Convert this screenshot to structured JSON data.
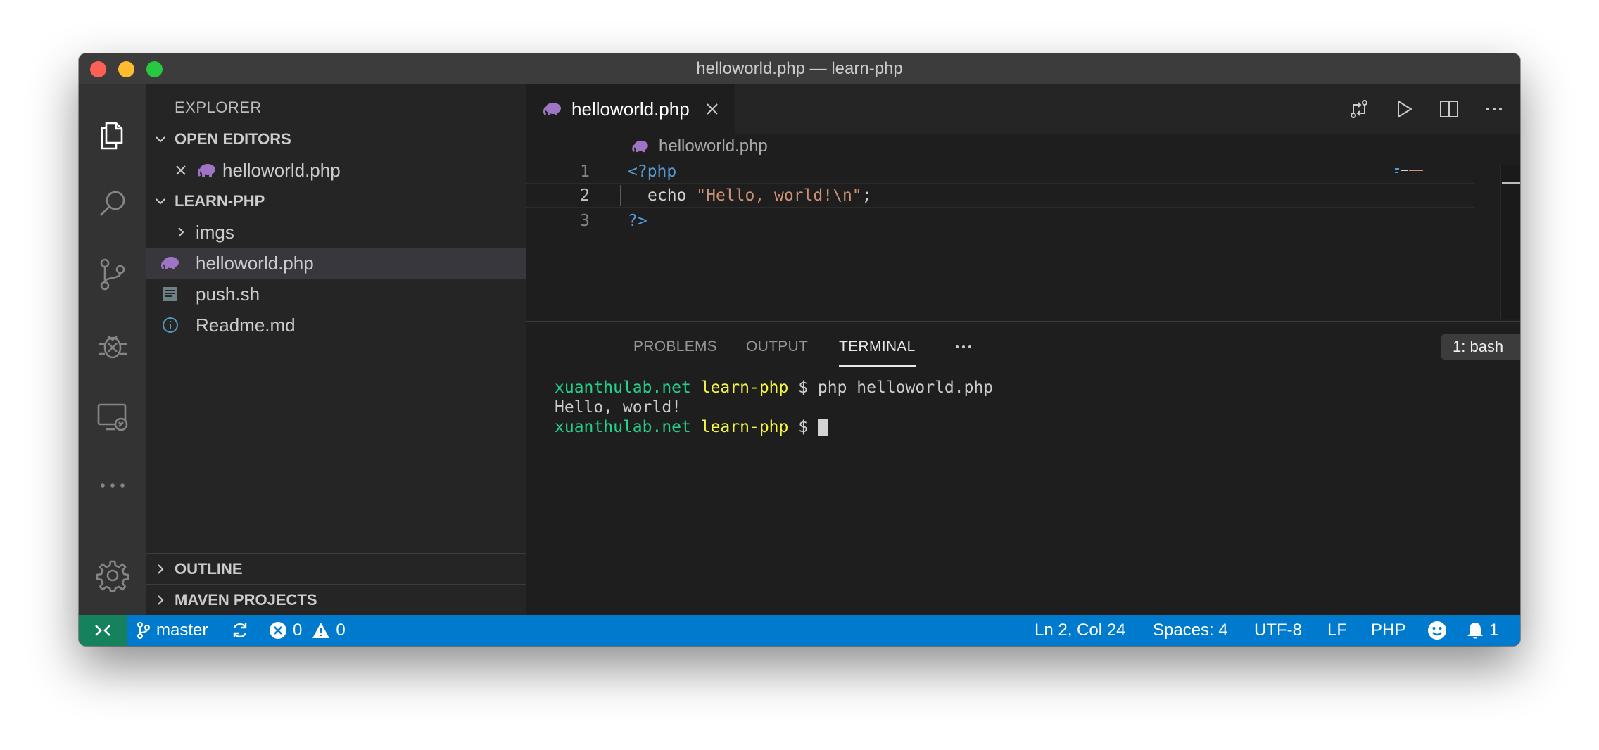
{
  "window": {
    "title": "helloworld.php — learn-php"
  },
  "sidebar": {
    "title": "EXPLORER",
    "open_editors": {
      "label": "OPEN EDITORS",
      "items": [
        {
          "name": "helloworld.php"
        }
      ]
    },
    "project": {
      "label": "LEARN-PHP",
      "items": [
        {
          "name": "imgs",
          "type": "folder"
        },
        {
          "name": "helloworld.php",
          "type": "php"
        },
        {
          "name": "push.sh",
          "type": "shell"
        },
        {
          "name": "Readme.md",
          "type": "markdown"
        }
      ]
    },
    "outline_label": "OUTLINE",
    "maven_label": "MAVEN PROJECTS"
  },
  "editor": {
    "tab_label": "helloworld.php",
    "breadcrumb": "helloworld.php",
    "lines": [
      {
        "num": "1",
        "parts": [
          "<?php"
        ]
      },
      {
        "num": "2",
        "parts": [
          "echo ",
          "\"Hello, world!\\n\"",
          ";"
        ]
      },
      {
        "num": "3",
        "parts": [
          "?>"
        ]
      }
    ]
  },
  "panel": {
    "tabs": [
      "PROBLEMS",
      "OUTPUT",
      "TERMINAL"
    ],
    "active_tab": "TERMINAL",
    "terminal_select": "1: bash",
    "terminal": {
      "host": "xuanthulab.net",
      "dir": "learn-php",
      "prompt": " $ ",
      "command": "php helloworld.php",
      "output": "Hello, world!",
      "prompt2": " $ "
    }
  },
  "statusbar": {
    "branch": "master",
    "errors": "0",
    "warnings": "0",
    "position": "Ln 2, Col 24",
    "spaces": "Spaces: 4",
    "encoding": "UTF-8",
    "eol": "LF",
    "language": "PHP",
    "notifications": "1"
  },
  "colors": {
    "accent": "#007acc",
    "remote": "#16825d",
    "terminal_host": "#23d18b",
    "terminal_dir": "#f5f543",
    "php_icon": "#a074c4"
  },
  "icons": [
    "files-icon",
    "search-icon",
    "source-control-icon",
    "debug-icon",
    "remote-explorer-icon",
    "more-icon",
    "gear-icon",
    "php-elephant-icon",
    "close-icon",
    "chevron-down-icon",
    "chevron-right-icon",
    "compare-changes-icon",
    "run-icon",
    "split-editor-icon",
    "ellipsis-icon",
    "plus-icon",
    "trash-icon",
    "maximize-panel-icon",
    "remote-icon",
    "branch-icon",
    "sync-icon",
    "error-icon",
    "warning-icon",
    "smiley-icon",
    "bell-icon",
    "info-icon",
    "shell-file-icon"
  ]
}
